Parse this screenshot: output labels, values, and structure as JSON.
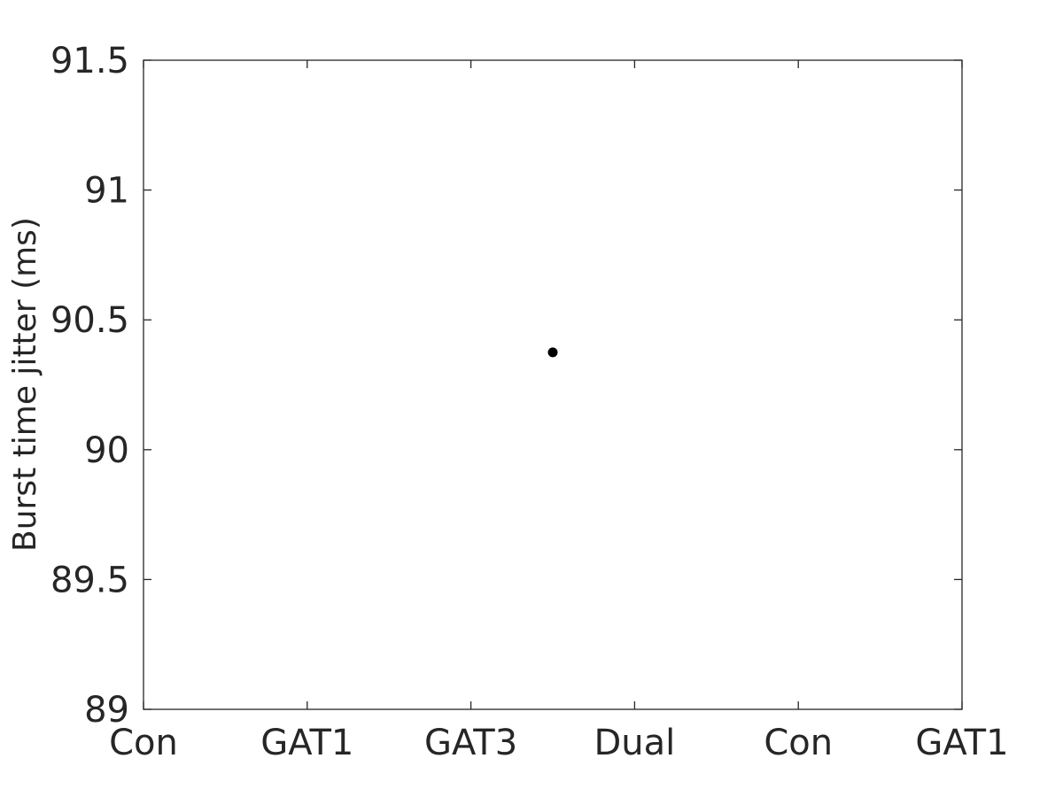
{
  "chart_data": {
    "type": "scatter",
    "title": "",
    "xlabel": "",
    "ylabel": "Burst time jitter (ms)",
    "x_ticks": [
      1,
      2,
      3,
      4,
      5,
      6
    ],
    "x_tick_labels": [
      "Con",
      "GAT1",
      "GAT3",
      "Dual",
      "Con",
      "GAT1"
    ],
    "xlim": [
      1,
      6
    ],
    "y_ticks": [
      89,
      89.5,
      90,
      90.5,
      91,
      91.5
    ],
    "y_tick_labels": [
      "89",
      "89.5",
      "90",
      "90.5",
      "91",
      "91.5"
    ],
    "ylim": [
      89,
      91.5
    ],
    "grid": false,
    "series": [
      {
        "name": "data",
        "color": "#000000",
        "points": [
          {
            "x": 3.5,
            "y": 90.375
          }
        ]
      }
    ]
  }
}
